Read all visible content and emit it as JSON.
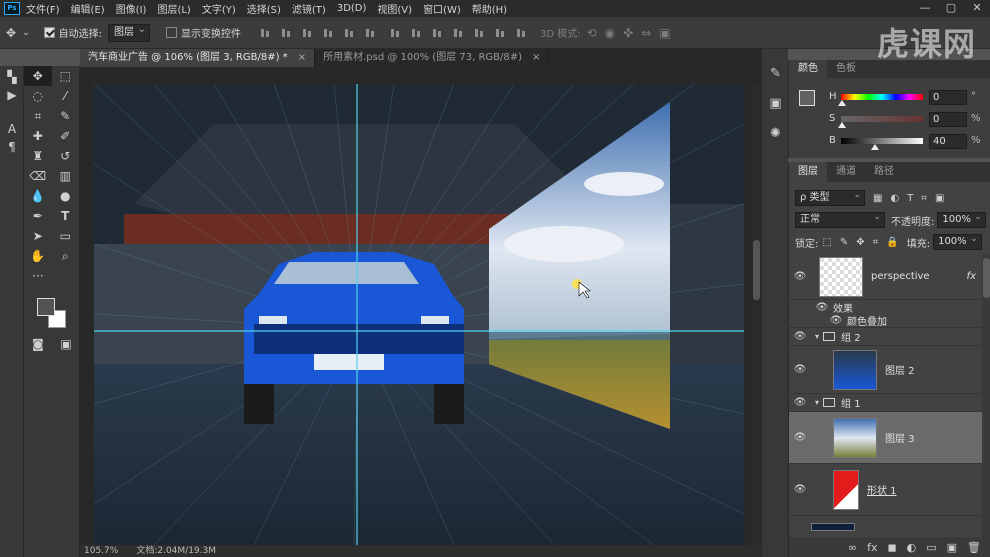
{
  "app": {
    "logo": "Ps"
  },
  "menu": [
    "文件(F)",
    "编辑(E)",
    "图像(I)",
    "图层(L)",
    "文字(Y)",
    "选择(S)",
    "滤镜(T)",
    "3D(D)",
    "视图(V)",
    "窗口(W)",
    "帮助(H)"
  ],
  "window_controls": {
    "minimize": "—",
    "maximize": "▢",
    "close": "✕"
  },
  "options": {
    "auto_select_label": "自动选择:",
    "auto_select_value": "图层",
    "show_transform_label": "显示变换控件",
    "mode_3d_label": "3D 模式:"
  },
  "watermark": "虎课网",
  "tabs": [
    {
      "label": "汽车商业广告 @ 106% (图层 3, RGB/8#) *",
      "close": "×"
    },
    {
      "label": "所用素材.psd @ 100% (图层 73, RGB/8#)",
      "close": "×"
    }
  ],
  "status": {
    "zoom": "105.7%",
    "doc": "文档:2.04M/19.3M"
  },
  "color_panel": {
    "tabs": [
      "颜色",
      "色板"
    ],
    "rows": [
      {
        "label": "H",
        "value": "0",
        "unit": "°"
      },
      {
        "label": "S",
        "value": "0",
        "unit": "%"
      },
      {
        "label": "B",
        "value": "40",
        "unit": "%"
      }
    ]
  },
  "layers_panel": {
    "tabs": [
      "图层",
      "通道",
      "路径"
    ],
    "filter_kind": "ρ 类型",
    "blend_mode": "正常",
    "opacity_label": "不透明度:",
    "opacity_value": "100%",
    "lock_label": "锁定:",
    "fill_label": "填充:",
    "fill_value": "100%",
    "layers": [
      {
        "name": "perspective",
        "fx": "fx"
      },
      {
        "name": "效果"
      },
      {
        "name": "颜色叠加"
      },
      {
        "name": "组 2"
      },
      {
        "name": "图层 2"
      },
      {
        "name": "组 1"
      },
      {
        "name": "图层 3"
      },
      {
        "name": "形状 1"
      }
    ],
    "footer_icons": [
      "∞",
      "fx",
      "◼",
      "◐",
      "▭",
      "▣",
      "🗑"
    ]
  },
  "colors": {
    "accent": "#31a8ff",
    "guide": "#4fd3e8",
    "car": "#1957d6"
  }
}
